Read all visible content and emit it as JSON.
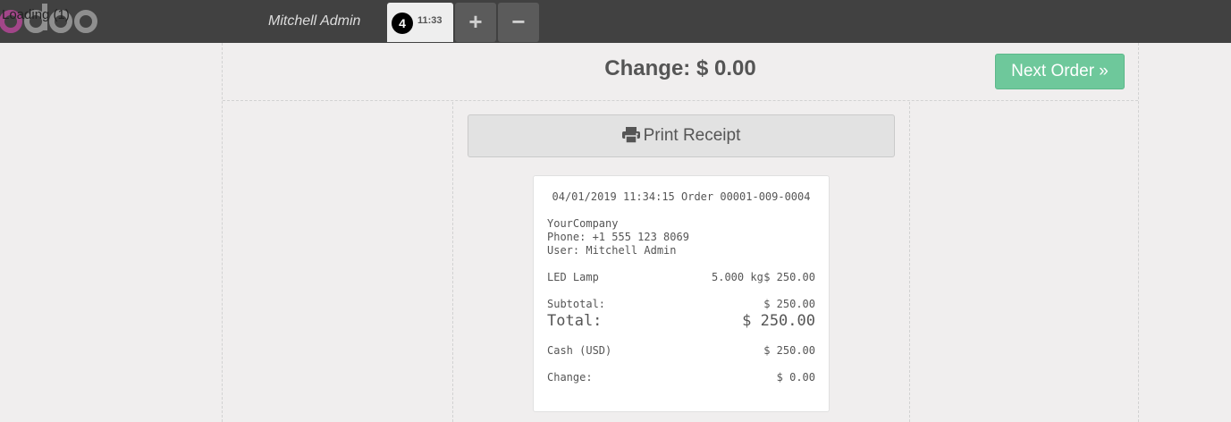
{
  "header": {
    "logo_text": "odoo",
    "loading_text": "Loading (1)",
    "cashier_name": "Mitchell Admin",
    "order_tab": {
      "number": "4",
      "time": "11:33"
    },
    "add_order_label": "+",
    "remove_order_label": "−"
  },
  "payment": {
    "change_label": "Change: $ 0.00",
    "next_order_label": "Next Order »",
    "print_receipt_label": "Print Receipt"
  },
  "receipt": {
    "header_line": "04/01/2019 11:34:15 Order 00001-009-0004",
    "company": "YourCompany",
    "phone": "Phone: +1 555 123 8069",
    "user": "User: Mitchell Admin",
    "orderlines": [
      {
        "product": "LED Lamp",
        "qty": "5.000 kg",
        "price": "$ 250.00"
      }
    ],
    "subtotal_label": "Subtotal:",
    "subtotal_value": "$ 250.00",
    "total_label": "Total:",
    "total_value": "$ 250.00",
    "payment_label": "Cash (USD)",
    "payment_value": "$ 250.00",
    "change_label": "Change:",
    "change_value": "$ 0.00"
  },
  "colors": {
    "topbar": "#414141",
    "background": "#f0eeee",
    "accent_green": "#6ec89b",
    "logo_purple": "#a24689",
    "logo_gray": "#8f8f8f"
  },
  "icons": [
    "odoo-logo",
    "print-icon",
    "plus-icon",
    "minus-icon"
  ]
}
